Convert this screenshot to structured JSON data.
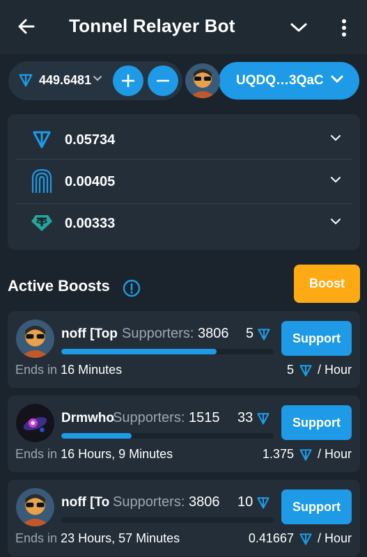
{
  "header": {
    "title": "Tonnel Relayer Bot",
    "back_icon": "back-arrow-icon",
    "dropdown_icon": "chevron-down-icon",
    "menu_icon": "more-vertical-icon"
  },
  "wallet": {
    "balance": "449.6481",
    "address": "UQDQ…3QaC",
    "accent_color": "#1e9ae6"
  },
  "tokens": [
    {
      "icon": "ton-icon",
      "value": "0.05734"
    },
    {
      "icon": "tonnel-fingerprint-icon",
      "value": "0.00405"
    },
    {
      "icon": "tether-icon",
      "value": "0.00333"
    }
  ],
  "boosts_section": {
    "title": "Active Boosts",
    "boost_button": "Boost",
    "boost_color": "#fdaa14"
  },
  "boosts": [
    {
      "name": "noff [Top",
      "supporters_label": "Supporters:",
      "supporters": "3806",
      "amount": "5",
      "progress": 0.73,
      "support_label": "Support",
      "ends_label": "Ends in",
      "ends_value": "16 Minutes",
      "rate_value": "5",
      "rate_unit": "/ Hour"
    },
    {
      "name": "Drmwho",
      "supporters_label": "Supporters:",
      "supporters": "1515",
      "amount": "33",
      "progress": 0.33,
      "support_label": "Support",
      "ends_label": "Ends in",
      "ends_value": "16 Hours, 9 Minutes",
      "rate_value": "1.375",
      "rate_unit": "/ Hour"
    },
    {
      "name": "noff [To",
      "supporters_label": "Supporters:",
      "supporters": "3806",
      "amount": "10",
      "progress": 0.0,
      "support_label": "Support",
      "ends_label": "Ends in",
      "ends_value": "23 Hours, 57 Minutes",
      "rate_value": "0.41667",
      "rate_unit": "/ Hour"
    }
  ]
}
